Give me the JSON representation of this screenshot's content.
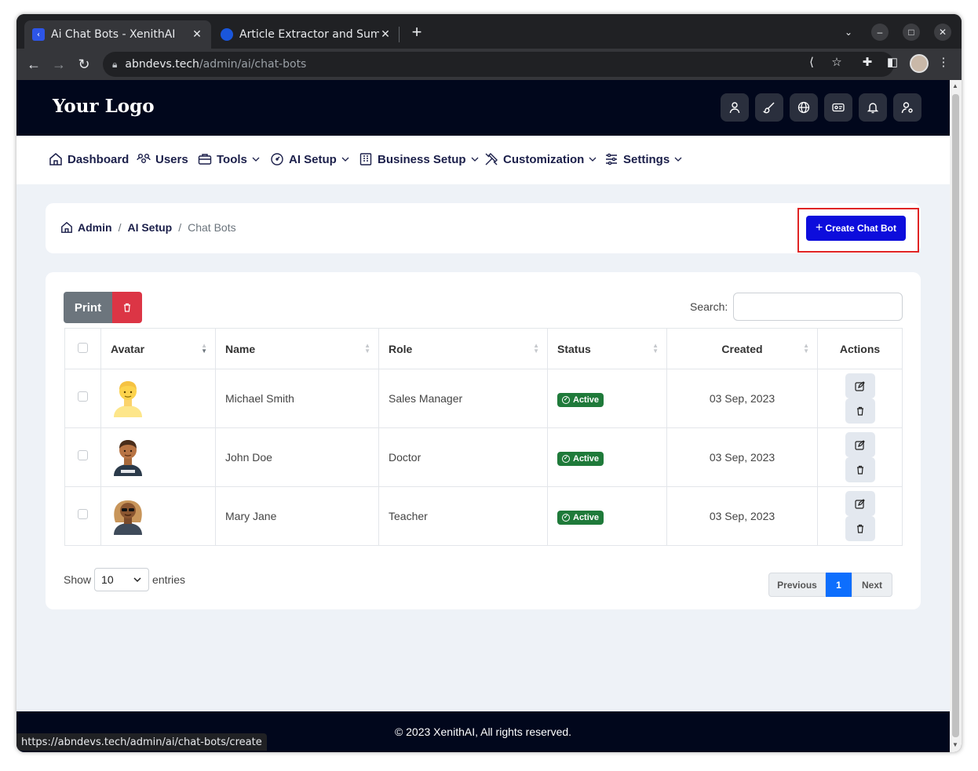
{
  "browser": {
    "tabs": [
      {
        "title": "Ai Chat Bots - XenithAI",
        "favicon_color": "#2d55e8"
      },
      {
        "title": "Article Extractor and Sum",
        "favicon_color": "#1a56db"
      }
    ],
    "address": {
      "host": "abndevs.tech",
      "path": "/admin/ai/chat-bots"
    },
    "status_url": "https://abndevs.tech/admin/ai/chat-bots/create"
  },
  "header": {
    "logo": "Your Logo",
    "icons": [
      "user-icon",
      "paint-brush-icon",
      "globe-icon",
      "id-card-icon",
      "bell-icon",
      "user-settings-icon"
    ]
  },
  "nav": {
    "items": [
      {
        "label": "Dashboard",
        "icon": "home-icon",
        "dropdown": false
      },
      {
        "label": "Users",
        "icon": "users-icon",
        "dropdown": false
      },
      {
        "label": "Tools",
        "icon": "toolbox-icon",
        "dropdown": true
      },
      {
        "label": "AI Setup",
        "icon": "gauge-icon",
        "dropdown": true
      },
      {
        "label": "Business Setup",
        "icon": "building-icon",
        "dropdown": true
      },
      {
        "label": "Customization",
        "icon": "tools-icon",
        "dropdown": true
      },
      {
        "label": "Settings",
        "icon": "sliders-icon",
        "dropdown": true
      }
    ]
  },
  "breadcrumb": {
    "items": [
      "Admin",
      "AI Setup"
    ],
    "current": "Chat Bots"
  },
  "create_button": "Create Chat Bot",
  "table_controls": {
    "print": "Print",
    "search_label": "Search:",
    "search_value": ""
  },
  "table": {
    "columns": [
      "Avatar",
      "Name",
      "Role",
      "Status",
      "Created",
      "Actions"
    ],
    "rows": [
      {
        "name": "Michael Smith",
        "role": "Sales Manager",
        "status": "Active",
        "created": "03 Sep, 2023",
        "avatar": "blond-man-avatar"
      },
      {
        "name": "John Doe",
        "role": "Doctor",
        "status": "Active",
        "created": "03 Sep, 2023",
        "avatar": "man-avatar"
      },
      {
        "name": "Mary Jane",
        "role": "Teacher",
        "status": "Active",
        "created": "03 Sep, 2023",
        "avatar": "woman-sunglasses-avatar"
      }
    ]
  },
  "length": {
    "show": "Show",
    "value": "10",
    "entries": "entries"
  },
  "pagination": {
    "previous": "Previous",
    "current": "1",
    "next": "Next"
  },
  "footer": "© 2023 XenithAI, All rights reserved.",
  "colors": {
    "header_bg": "#01071c",
    "primary": "#0d0ddc",
    "danger": "#dc3545",
    "active_badge": "#1f7a3a",
    "page_bg": "#eef2f7"
  }
}
